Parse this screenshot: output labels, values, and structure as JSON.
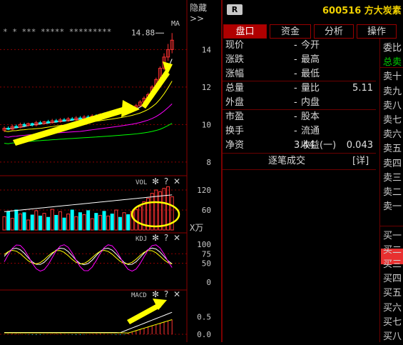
{
  "toolbar": {
    "hide_label": "隐藏>>"
  },
  "stock": {
    "badge": "R",
    "code_name": "600516 方大炭素"
  },
  "tabs": [
    {
      "label": "盘口"
    },
    {
      "label": "资金"
    },
    {
      "label": "分析"
    },
    {
      "label": "操作"
    }
  ],
  "quote": {
    "rows": [
      {
        "l1": "现价",
        "v1": "-",
        "l2": "今开",
        "v2": ""
      },
      {
        "l1": "涨跌",
        "v1": "-",
        "l2": "最高",
        "v2": ""
      },
      {
        "l1": "涨幅",
        "v1": "-",
        "l2": "最低",
        "v2": ""
      },
      {
        "l1": "总量",
        "v1": "-",
        "l2": "量比",
        "v2": "5.11"
      },
      {
        "l1": "外盘",
        "v1": "-",
        "l2": "内盘",
        "v2": ""
      },
      {
        "l1": "市盈",
        "v1": "-",
        "l2": "股本",
        "v2": ""
      },
      {
        "l1": "换手",
        "v1": "-",
        "l2": "流通",
        "v2": ""
      },
      {
        "l1": "净资",
        "v1": "3.44",
        "l2": "收益(一)",
        "v2": "0.043"
      }
    ],
    "trades_title": "逐笔成交",
    "detail_label": "[详]"
  },
  "order_book": {
    "labels": [
      "委比",
      "总卖",
      "卖十",
      "卖九",
      "卖八",
      "卖七",
      "卖六",
      "卖五",
      "卖四",
      "卖三",
      "卖二",
      "卖一",
      "",
      "买一",
      "买二",
      "买三",
      "买四",
      "买五",
      "买六",
      "买七",
      "买八"
    ]
  },
  "main_chart": {
    "indicator": "MA",
    "star_row": "* * ***  ***** *********",
    "peak_label": "14.88",
    "y_ticks": [
      "14",
      "12",
      "10",
      "8"
    ]
  },
  "vol_panel": {
    "title": "VOL",
    "y_ticks": [
      "120",
      "60"
    ],
    "unit": "X万"
  },
  "kdj_panel": {
    "title": "KDJ",
    "y_ticks": [
      "100",
      "75",
      "50",
      "0"
    ]
  },
  "macd_panel": {
    "title": "MACD",
    "y_ticks": [
      "0.5",
      "0.0"
    ]
  },
  "panel_buttons": {
    "gear": "✻",
    "help": "?",
    "close": "✕"
  },
  "colors": {
    "up": "#ff3232",
    "down": "#00ffff",
    "ma5": "#ffffff",
    "ma10": "#ffff00",
    "ma20": "#ff00ff",
    "ma60": "#00ff00",
    "grid": "#8b0000",
    "arrow": "#ffff00"
  },
  "chart_data": {
    "type": "candlestick",
    "candles": [
      {
        "o": 9.7,
        "c": 9.8,
        "h": 9.9,
        "l": 9.6
      },
      {
        "o": 9.8,
        "c": 9.75,
        "h": 9.9,
        "l": 9.7
      },
      {
        "o": 9.75,
        "c": 9.9,
        "h": 10.0,
        "l": 9.7
      },
      {
        "o": 9.9,
        "c": 9.85,
        "h": 10.0,
        "l": 9.8
      },
      {
        "o": 9.85,
        "c": 10.0,
        "h": 10.1,
        "l": 9.8
      },
      {
        "o": 10.0,
        "c": 9.95,
        "h": 10.1,
        "l": 9.9
      },
      {
        "o": 9.95,
        "c": 10.05,
        "h": 10.1,
        "l": 9.9
      },
      {
        "o": 10.05,
        "c": 9.98,
        "h": 10.1,
        "l": 9.9
      },
      {
        "o": 9.98,
        "c": 10.1,
        "h": 10.2,
        "l": 9.9
      },
      {
        "o": 10.1,
        "c": 10.05,
        "h": 10.2,
        "l": 10.0
      },
      {
        "o": 10.05,
        "c": 10.15,
        "h": 10.2,
        "l": 10.0
      },
      {
        "o": 10.15,
        "c": 10.1,
        "h": 10.25,
        "l": 10.05
      },
      {
        "o": 10.1,
        "c": 10.2,
        "h": 10.3,
        "l": 10.05
      },
      {
        "o": 10.2,
        "c": 10.15,
        "h": 10.3,
        "l": 10.1
      },
      {
        "o": 10.15,
        "c": 10.25,
        "h": 10.35,
        "l": 10.1
      },
      {
        "o": 10.25,
        "c": 10.2,
        "h": 10.35,
        "l": 10.15
      },
      {
        "o": 10.2,
        "c": 10.3,
        "h": 10.4,
        "l": 10.15
      },
      {
        "o": 10.3,
        "c": 10.25,
        "h": 10.4,
        "l": 10.2
      },
      {
        "o": 10.25,
        "c": 10.35,
        "h": 10.45,
        "l": 10.2
      },
      {
        "o": 10.35,
        "c": 10.3,
        "h": 10.45,
        "l": 10.25
      },
      {
        "o": 10.3,
        "c": 10.4,
        "h": 10.5,
        "l": 10.25
      },
      {
        "o": 10.4,
        "c": 10.35,
        "h": 10.5,
        "l": 10.3
      },
      {
        "o": 10.35,
        "c": 10.45,
        "h": 10.55,
        "l": 10.3
      },
      {
        "o": 10.45,
        "c": 10.4,
        "h": 10.55,
        "l": 10.35
      },
      {
        "o": 10.4,
        "c": 10.55,
        "h": 10.6,
        "l": 10.35
      },
      {
        "o": 10.55,
        "c": 10.5,
        "h": 10.65,
        "l": 10.45
      },
      {
        "o": 10.5,
        "c": 10.6,
        "h": 10.7,
        "l": 10.45
      },
      {
        "o": 10.6,
        "c": 10.55,
        "h": 10.7,
        "l": 10.5
      },
      {
        "o": 10.55,
        "c": 10.7,
        "h": 10.8,
        "l": 10.5
      },
      {
        "o": 10.7,
        "c": 10.65,
        "h": 10.8,
        "l": 10.6
      },
      {
        "o": 10.65,
        "c": 10.8,
        "h": 10.9,
        "l": 10.6
      },
      {
        "o": 10.8,
        "c": 10.75,
        "h": 10.9,
        "l": 10.7
      },
      {
        "o": 10.75,
        "c": 10.9,
        "h": 11.0,
        "l": 10.7
      },
      {
        "o": 10.9,
        "c": 11.0,
        "h": 11.1,
        "l": 10.85
      },
      {
        "o": 11.0,
        "c": 11.2,
        "h": 11.3,
        "l": 10.95
      },
      {
        "o": 11.2,
        "c": 11.4,
        "h": 11.5,
        "l": 11.1
      },
      {
        "o": 11.4,
        "c": 11.6,
        "h": 11.7,
        "l": 11.3
      },
      {
        "o": 11.6,
        "c": 12.0,
        "h": 12.1,
        "l": 11.5
      },
      {
        "o": 12.0,
        "c": 12.4,
        "h": 12.5,
        "l": 11.9
      },
      {
        "o": 12.4,
        "c": 13.0,
        "h": 13.1,
        "l": 12.3
      },
      {
        "o": 13.0,
        "c": 13.6,
        "h": 13.8,
        "l": 12.9
      },
      {
        "o": 13.6,
        "c": 14.0,
        "h": 14.3,
        "l": 13.4
      },
      {
        "o": 14.0,
        "c": 14.5,
        "h": 14.88,
        "l": 13.8
      }
    ],
    "volumes": [
      40,
      55,
      35,
      60,
      48,
      52,
      30,
      45,
      58,
      42,
      50,
      38,
      62,
      44,
      55,
      36,
      48,
      60,
      40,
      52,
      46,
      58,
      34,
      50,
      44,
      56,
      42,
      48,
      60,
      38,
      52,
      46,
      56,
      62,
      70,
      85,
      95,
      110,
      120,
      115,
      125,
      130,
      100
    ],
    "ylim": [
      7.5,
      15.5
    ],
    "vol_ylim": [
      0,
      150
    ]
  }
}
